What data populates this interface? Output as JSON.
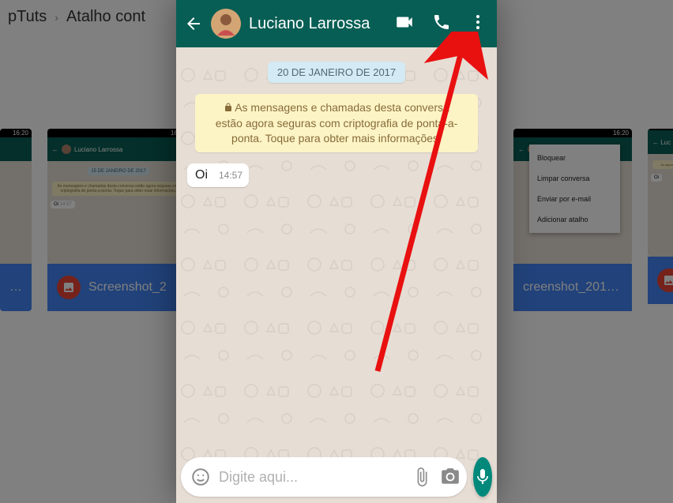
{
  "breadcrumb": {
    "site": "pTuts",
    "page": "Atalho cont"
  },
  "background_thumbs": {
    "status_time": "16:20",
    "contact": "Luciano Larrossa",
    "date": "15 DE JANEIRO DE 2017",
    "encrypt": "As mensagens e chamadas desta conversa estão agora seguras com criptografia de ponta-a-ponta. Toque para obter mais informações.",
    "msg": "Oi",
    "msg_time": "14:57",
    "footer_label": "Screenshot_2",
    "footer_label2": "creenshot_201…",
    "menu": [
      "Bloquear",
      "Limpar conversa",
      "Enviar por e-mail",
      "Adicionar atalho"
    ]
  },
  "chat": {
    "contact_name": "Luciano Larrossa",
    "date_label": "20 DE JANEIRO DE 2017",
    "encryption_notice": "As mensagens e chamadas desta conversa estão agora seguras com criptografia de ponta-a-ponta. Toque para obter mais informações.",
    "messages": [
      {
        "text": "Oi",
        "time": "14:57"
      }
    ],
    "input_placeholder": "Digite aqui..."
  },
  "icons": {
    "back": "back-arrow",
    "video": "video-camera",
    "voice": "phone",
    "menu": "more-vert",
    "lock": "lock",
    "emoji": "emoji-face",
    "attach": "paperclip",
    "camera": "camera",
    "mic": "microphone",
    "image": "image"
  }
}
